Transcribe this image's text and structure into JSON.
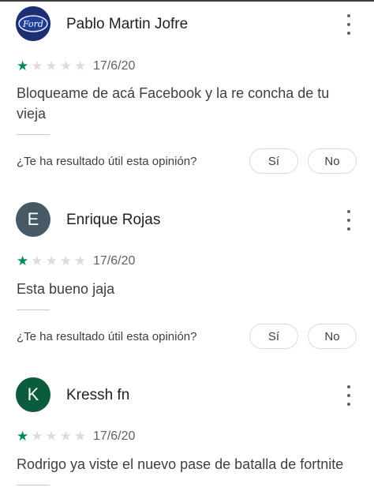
{
  "reviews": [
    {
      "author": "Pablo Martin Jofre",
      "avatar_logo_text": "Ford",
      "rating": 1,
      "date": "17/6/20",
      "text": "Bloqueame de acá Facebook y la re concha de tu vieja",
      "helpful_question": "¿Te ha resultado útil esta opinión?",
      "yes_label": "Sí",
      "no_label": "No"
    },
    {
      "author": "Enrique Rojas",
      "avatar_letter": "E",
      "avatar_color": "#455a64",
      "rating": 1,
      "date": "17/6/20",
      "text": "Esta bueno jaja",
      "helpful_question": "¿Te ha resultado útil esta opinión?",
      "yes_label": "Sí",
      "no_label": "No"
    },
    {
      "author": "Kressh fn",
      "avatar_letter": "K",
      "avatar_color": "#0b5b3d",
      "rating": 1,
      "date": "17/6/20",
      "text": "Rodrigo ya viste el nuevo pase de batalla de fortnite"
    }
  ],
  "colors": {
    "star_filled": "#01875f",
    "star_empty": "#dadce0"
  }
}
